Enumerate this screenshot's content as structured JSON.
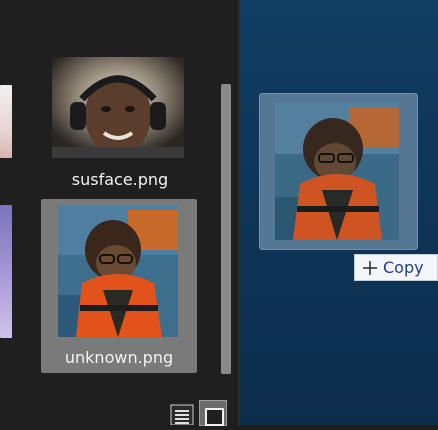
{
  "files": [
    {
      "name": "susface.png"
    },
    {
      "name": "unknown.png",
      "selected": true
    }
  ],
  "drag": {
    "tooltip_label": "Copy",
    "tooltip_icon": "plus-icon"
  },
  "colors": {
    "panel_bg": "#1f1f1f",
    "selected_tile_bg": "#7a7a7a",
    "desktop_bg": "#0f3557",
    "tooltip_text": "#1f3f8f"
  },
  "view_controls": [
    {
      "icon": "list-view-icon"
    },
    {
      "icon": "grid-view-icon",
      "active": true
    }
  ]
}
